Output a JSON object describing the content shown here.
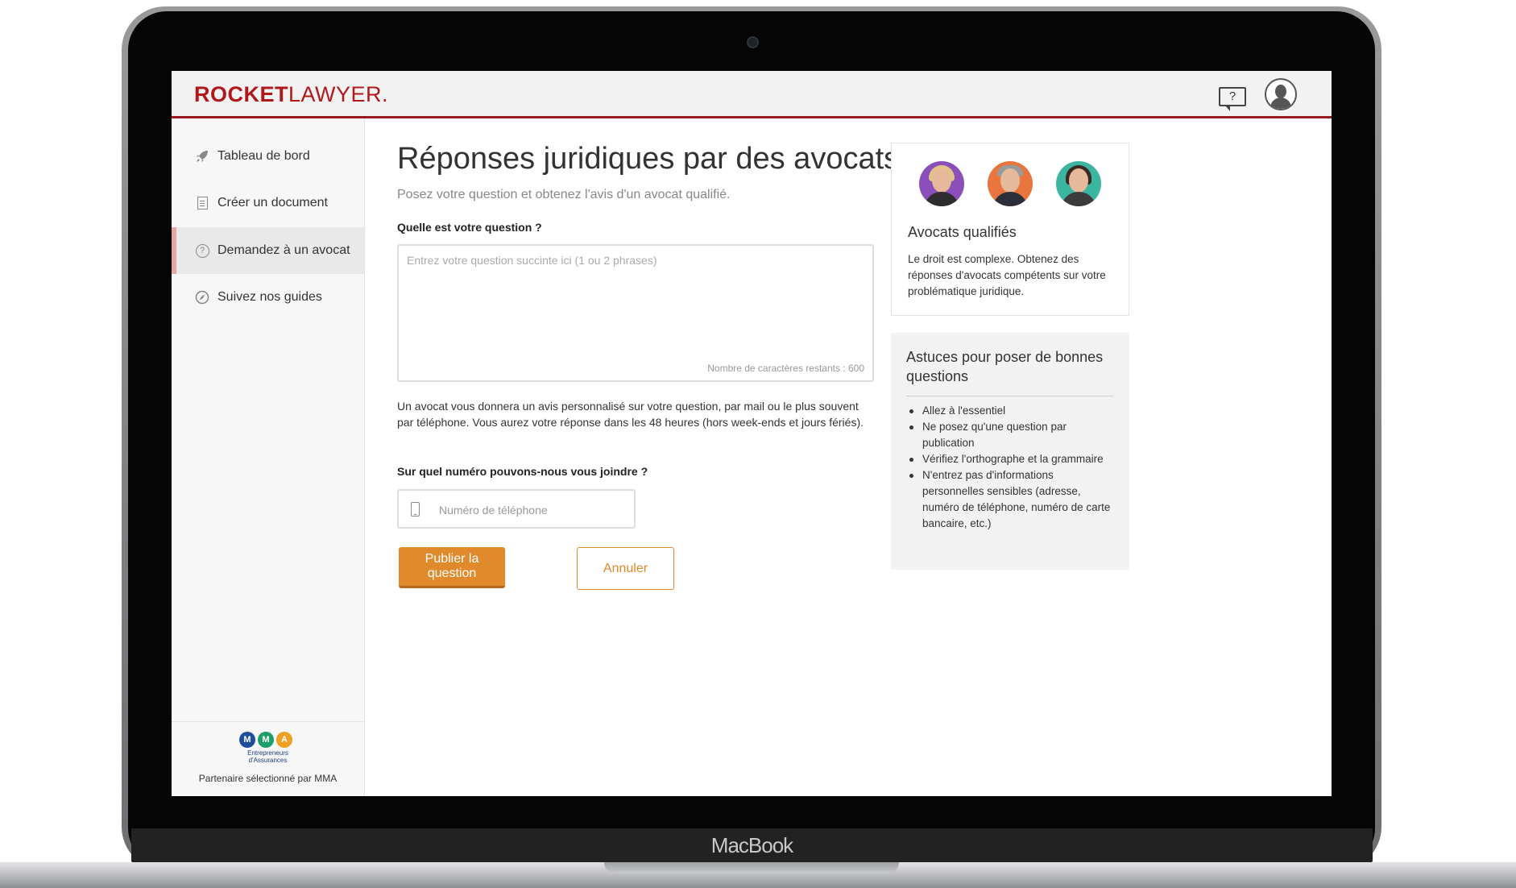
{
  "device": {
    "label": "MacBook"
  },
  "header": {
    "logo_bold": "ROCKET",
    "logo_light": "LAWYER",
    "logo_mark": ".",
    "help_icon_text": "?"
  },
  "sidebar": {
    "items": [
      {
        "label": "Tableau de bord",
        "icon": "rocket-icon"
      },
      {
        "label": "Créer un document",
        "icon": "document-icon"
      },
      {
        "label": "Demandez à un avocat",
        "icon": "question-circle-icon",
        "active": true
      },
      {
        "label": "Suivez nos guides",
        "icon": "compass-icon"
      }
    ],
    "partner": {
      "logo_letters": [
        "M",
        "M",
        "A"
      ],
      "logo_colors": [
        "#1f4e9c",
        "#1e9e6b",
        "#f0a020"
      ],
      "logo_sub_1": "Entrepreneurs",
      "logo_sub_2": "d'Assurances",
      "text": "Partenaire sélectionné par MMA"
    }
  },
  "main": {
    "title": "Réponses juridiques par des avocats",
    "subtitle": "Posez votre question et obtenez l'avis d'un avocat qualifié.",
    "question_label": "Quelle est votre question ?",
    "question_placeholder": "Entrez votre question succinte ici (1 ou 2 phrases)",
    "char_count": "Nombre de caractères restants : 600",
    "info": "Un avocat vous donnera un avis personnalisé sur votre question, par mail ou le plus souvent par téléphone. Vous aurez votre réponse dans les 48 heures (hors week-ends et jours fériés).",
    "phone_label": "Sur quel numéro pouvons-nous vous joindre ?",
    "phone_placeholder": "Numéro de téléphone",
    "publish_button": "Publier la question",
    "cancel_button": "Annuler"
  },
  "lawyers_card": {
    "title": "Avocats qualifiés",
    "text": "Le droit est complexe. Obtenez des réponses d'avocats compétents sur votre problématique juridique.",
    "avatar_bg_colors": [
      "#8a4fb8",
      "#e8743e",
      "#3bb5a0"
    ]
  },
  "tips_card": {
    "title": "Astuces pour poser de bonnes questions",
    "items": [
      "Allez à l'essentiel",
      "Ne posez qu'une question par publication",
      "Vérifiez l'orthographe et la grammaire",
      "N'entrez pas d'informations personnelles sensibles (adresse, numéro de téléphone, numéro de carte bancaire, etc.)"
    ]
  },
  "colors": {
    "brand_red": "#b0181b",
    "accent_orange": "#e08a2c",
    "header_bg": "#f2f2f2"
  }
}
